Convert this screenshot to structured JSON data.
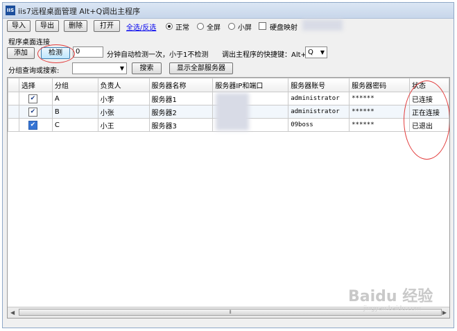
{
  "window": {
    "title": "iis7远程桌面管理 Alt+Q调出主程序",
    "icon_text": "IIS"
  },
  "toolbar": {
    "import_label": "导入",
    "export_label": "导出",
    "delete_label": "删除",
    "open_label": "打开",
    "select_toggle_link": "全选/反选",
    "mode_normal": "正常",
    "mode_full": "全屏",
    "mode_small": "小屏",
    "disk_map_label": "硬盘映射",
    "selected_mode": "正常",
    "disk_map_checked": false
  },
  "connection": {
    "group_label": "程序桌面连接",
    "add_label": "添加",
    "check_label": "检测",
    "interval_value": "0",
    "interval_text": "分钟自动检测一次，小于1不检测",
    "hotkey_label": "调出主程序的快捷键：Alt+",
    "hotkey_value": "Q"
  },
  "search": {
    "label": "分组查询或搜索:",
    "select_value": "",
    "search_button": "搜索",
    "show_all_button": "显示全部服务器"
  },
  "table": {
    "headers": [
      "选择",
      "分组",
      "负责人",
      "服务器名称",
      "服务器IP和端口",
      "服务器账号",
      "服务器密码",
      "状态"
    ],
    "rows": [
      {
        "checked": true,
        "group": "A",
        "owner": "小李",
        "name": "服务器1",
        "ip": "",
        "account": "administrator",
        "password": "******",
        "status": "已连接"
      },
      {
        "checked": true,
        "group": "B",
        "owner": "小张",
        "name": "服务器2",
        "ip": "",
        "account": "administrator",
        "password": "******",
        "status": "正在连接"
      },
      {
        "checked": true,
        "group": "C",
        "owner": "小王",
        "name": "服务器3",
        "ip": "",
        "account": "09boss",
        "password": "******",
        "status": "已退出"
      }
    ]
  },
  "watermark": {
    "brand": "Baidu 经验",
    "url": "jingyan.baidu.com"
  },
  "colors": {
    "annotation": "#e23c3c",
    "link": "#0000ee",
    "titlebar": "#c7d6ea"
  }
}
